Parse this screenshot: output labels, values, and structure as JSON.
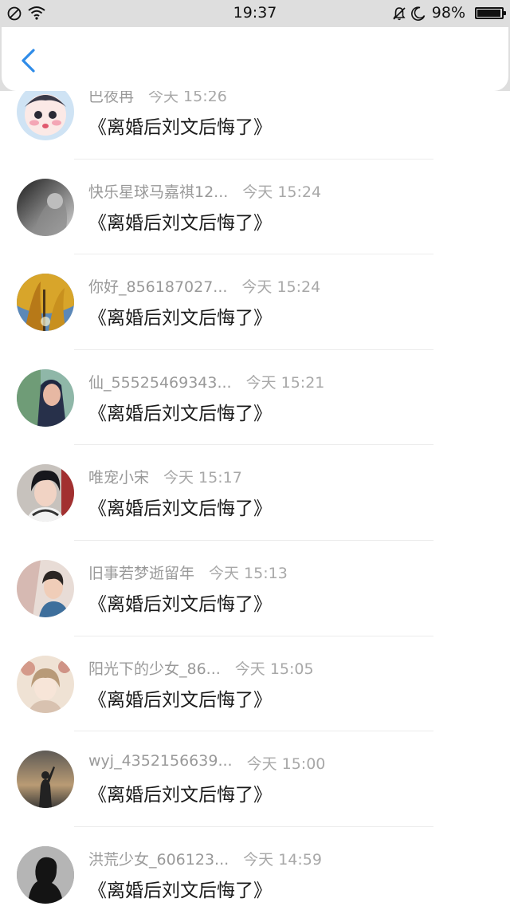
{
  "status_bar": {
    "time": "19:37",
    "battery_percent": "98%",
    "battery_level": 0.98,
    "icons": [
      "dnd-icon",
      "wifi-icon",
      "bell-muted-icon",
      "moon-icon",
      "battery-icon"
    ]
  },
  "header": {
    "back_icon": "chevron-left-icon",
    "accent_color": "#2f8ce8"
  },
  "comments": [
    {
      "name": "巴夜冉",
      "time": "今天 15:26",
      "text": "《离婚后刘文后悔了》"
    },
    {
      "name": "快乐星球马嘉祺12...",
      "time": "今天 15:24",
      "text": "《离婚后刘文后悔了》"
    },
    {
      "name": "你好_856187027...",
      "time": "今天 15:24",
      "text": "《离婚后刘文后悔了》"
    },
    {
      "name": "仙_55525469343...",
      "time": "今天 15:21",
      "text": "《离婚后刘文后悔了》"
    },
    {
      "name": "唯宠小宋",
      "time": "今天 15:17",
      "text": "《离婚后刘文后悔了》"
    },
    {
      "name": "旧事若梦逝留年",
      "time": "今天 15:13",
      "text": "《离婚后刘文后悔了》"
    },
    {
      "name": "阳光下的少女_86...",
      "time": "今天 15:05",
      "text": "《离婚后刘文后悔了》"
    },
    {
      "name": "wyj_4352156639...",
      "time": "今天 15:00",
      "text": "《离婚后刘文后悔了》"
    },
    {
      "name": "洪荒少女_606123...",
      "time": "今天 14:59",
      "text": "《离婚后刘文后悔了》"
    }
  ]
}
